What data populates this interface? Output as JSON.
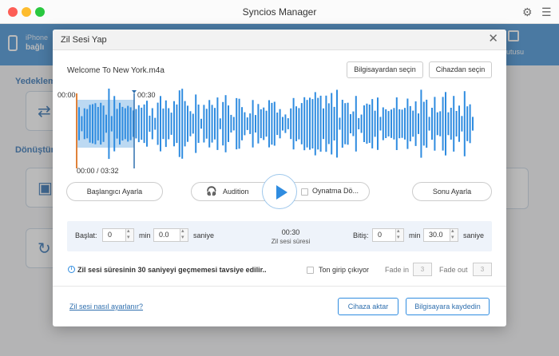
{
  "window": {
    "title": "Syncios Manager",
    "settings_icon": "gear-icon",
    "menu_icon": "hamburger-icon"
  },
  "device": {
    "name": "iPhone",
    "status": "bağlı"
  },
  "toolbox": {
    "label": "utusu"
  },
  "background": {
    "section1": "Yedekleme",
    "section2": "Dönüştürm"
  },
  "dialog": {
    "title": "Zil Sesi Yap",
    "file_name": "Welcome To New York.m4a",
    "buttons": {
      "from_pc": "Bilgisayardan seçin",
      "from_device": "Cihazdan seçin"
    },
    "waveform": {
      "selection_start": "00:00",
      "selection_end": "00:30",
      "position": "00:00 / 03:32",
      "accent": "#2f8ce0",
      "marker": "#e0823a"
    },
    "controls": {
      "set_start": "Başlangıcı Ayarla",
      "set_end": "Sonu Ayarla",
      "audition": "Audition",
      "loop_play": "Oynatma Dö..."
    },
    "settings": {
      "start_label": "Başlat:",
      "start_min": "0",
      "start_sec": "0.0",
      "min_unit": "min",
      "sec_unit": "saniye",
      "duration_value": "00:30",
      "duration_caption": "Zil sesi süresi",
      "end_label": "Bitiş:",
      "end_min": "0",
      "end_sec": "30.0"
    },
    "info_text": "Zil sesi süresinin 30 saniyeyi geçmemesi tavsiye edilir..",
    "fade": {
      "toggle_label": "Ton girip çıkıyor",
      "fade_in_label": "Fade in",
      "fade_in_value": "3",
      "fade_out_label": "Fade out",
      "fade_out_value": "3"
    },
    "footer": {
      "help_link": "Zil sesi nasıl ayarlanır?",
      "export_device": "Cihaza aktar",
      "save_pc": "Bilgisayara kaydedin"
    }
  }
}
